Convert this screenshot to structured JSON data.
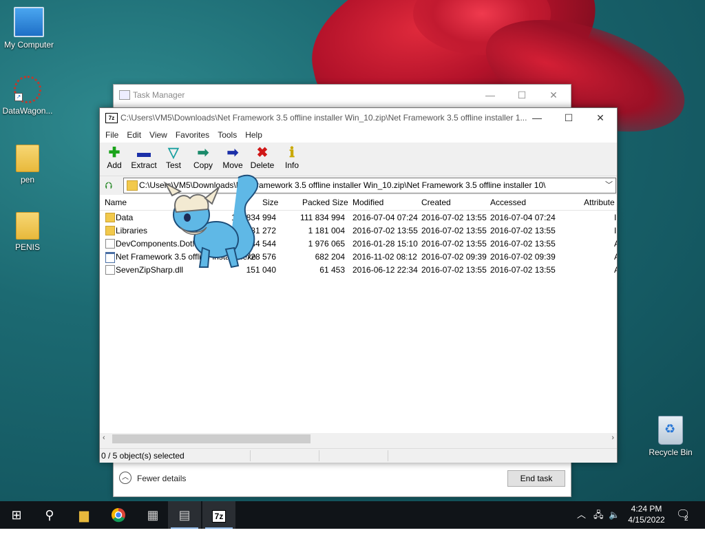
{
  "desktop": {
    "icons": [
      {
        "label": "My Computer"
      },
      {
        "label": "DataWagon..."
      },
      {
        "label": "pen"
      },
      {
        "label": "PENIS"
      },
      {
        "label": "Recycle Bin"
      }
    ]
  },
  "task_manager": {
    "title": "Task Manager",
    "fewer_details": "Fewer details",
    "end_task": "End task"
  },
  "zip": {
    "title": "C:\\Users\\VM5\\Downloads\\Net Framework 3.5 offline installer Win_10.zip\\Net Framework 3.5 offline installer 1...",
    "menu": [
      "File",
      "Edit",
      "View",
      "Favorites",
      "Tools",
      "Help"
    ],
    "toolbar": [
      {
        "label": "Add",
        "icon": "plus-icon",
        "color": "#1aa31a"
      },
      {
        "label": "Extract",
        "icon": "minus-icon",
        "color": "#1b2fa8"
      },
      {
        "label": "Test",
        "icon": "check-icon",
        "color": "#1aa0a0"
      },
      {
        "label": "Copy",
        "icon": "copy-arrow-icon",
        "color": "#1a8a6a"
      },
      {
        "label": "Move",
        "icon": "move-arrow-icon",
        "color": "#1b2fa8"
      },
      {
        "label": "Delete",
        "icon": "x-icon",
        "color": "#d01818"
      },
      {
        "label": "Info",
        "icon": "info-icon",
        "color": "#c9a800"
      }
    ],
    "address": "C:\\Users\\VM5\\Downloads\\Net Framework 3.5 offline installer Win_10.zip\\Net Framework 3.5 offline installer 10\\",
    "columns": [
      "Name",
      "Size",
      "Packed Size",
      "Modified",
      "Created",
      "Accessed",
      "Attribute"
    ],
    "rows": [
      {
        "name": "Data",
        "type": "folder",
        "size": "111 834 994",
        "packed": "111 834 994",
        "modified": "2016-07-04 07:24",
        "created": "2016-07-02 13:55",
        "accessed": "2016-07-04 07:24",
        "attr": "I"
      },
      {
        "name": "Libraries",
        "type": "folder",
        "size": "1 181 272",
        "packed": "1 181 004",
        "modified": "2016-07-02 13:55",
        "created": "2016-07-02 13:55",
        "accessed": "2016-07-02 13:55",
        "attr": "I"
      },
      {
        "name": "DevComponents.DotNetBar2.dll",
        "type": "dll",
        "size": "5 484 544",
        "packed": "1 976 065",
        "modified": "2016-01-28 15:10",
        "created": "2016-07-02 13:55",
        "accessed": "2016-07-02 13:55",
        "attr": "A"
      },
      {
        "name": "Net Framework 3.5 offline installer.exe",
        "type": "exe",
        "size": "728 576",
        "packed": "682 204",
        "modified": "2016-11-02 08:12",
        "created": "2016-07-02 09:39",
        "accessed": "2016-07-02 09:39",
        "attr": "A"
      },
      {
        "name": "SevenZipSharp.dll",
        "type": "dll",
        "size": "151 040",
        "packed": "61 453",
        "modified": "2016-06-12 22:34",
        "created": "2016-07-02 13:55",
        "accessed": "2016-07-02 13:55",
        "attr": "A"
      }
    ],
    "status": "0 / 5 object(s) selected"
  },
  "taskbar": {
    "time": "4:24 PM",
    "date": "4/15/2022",
    "notifications": "2",
    "apps": [
      "start-icon",
      "search-icon",
      "file-explorer-icon",
      "chrome-icon",
      "app-icon",
      "task-manager-icon",
      "7zip-icon"
    ]
  }
}
